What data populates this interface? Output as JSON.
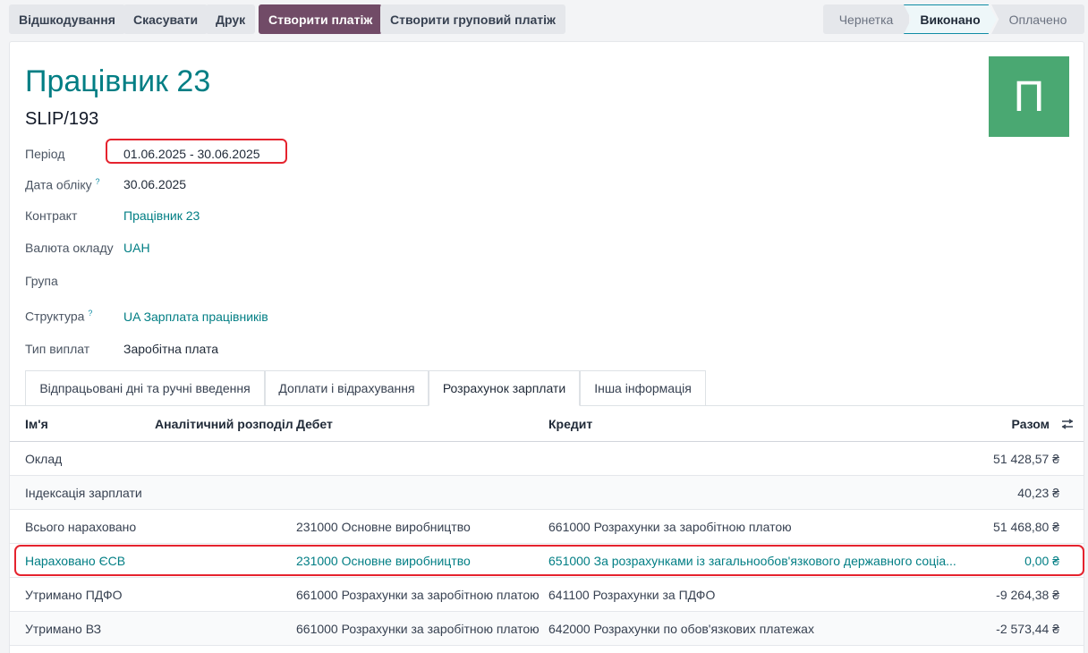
{
  "toolbar": {
    "refund": "Відшкодування",
    "cancel": "Скасувати",
    "print": "Друк",
    "create_payment": "Створити платіж",
    "create_group_payment": "Створити груповий платіж"
  },
  "status": {
    "draft": "Чернетка",
    "done": "Виконано",
    "paid": "Оплачено"
  },
  "employee": {
    "name": "Працівник 23",
    "slip": "SLIP/193",
    "avatar_letter": "П"
  },
  "fields": {
    "period_label": "Період",
    "period_value": "01.06.2025 - 30.06.2025",
    "accounting_date_label": "Дата обліку",
    "accounting_date_value": "30.06.2025",
    "contract_label": "Контракт",
    "contract_value": "Працівник 23",
    "currency_label": "Валюта окладу",
    "currency_value": "UAH",
    "group_label": "Група",
    "structure_label": "Структура",
    "structure_value": "UA Зарплата працівників",
    "payment_type_label": "Тип виплат",
    "payment_type_value": "Заробітна плата",
    "help_mark": "?"
  },
  "tabs": [
    "Відпрацьовані дні та ручні введення",
    "Доплати і відрахування",
    "Розрахунок зарплати",
    "Інша інформація"
  ],
  "table": {
    "headers": {
      "name": "Ім'я",
      "analytic": "Аналітичний розподіл",
      "debit": "Дебет",
      "credit": "Кредит",
      "total": "Разом"
    },
    "rows": [
      {
        "name": "Оклад",
        "debit": "",
        "credit": "",
        "total": "51 428,57 ₴"
      },
      {
        "name": "Індексація зарплати",
        "debit": "",
        "credit": "",
        "total": "40,23 ₴"
      },
      {
        "name": "Всього нараховано",
        "debit": "231000 Основне виробництво",
        "credit": "661000 Розрахунки за заробітною платою",
        "total": "51 468,80 ₴"
      },
      {
        "name": "Нараховано ЄСВ",
        "debit": "231000 Основне виробництво",
        "credit": "651000 За розрахунками із загальнообов'язкового державного соціа...",
        "total": "0,00 ₴"
      },
      {
        "name": "Утримано ПДФО",
        "debit": "661000 Розрахунки за заробітною платою",
        "credit": "641100 Розрахунки за ПДФО",
        "total": "-9 264,38 ₴"
      },
      {
        "name": "Утримано ВЗ",
        "debit": "661000 Розрахунки за заробітною платою",
        "credit": "642000 Розрахунки по обов'язкових платежах",
        "total": "-2 573,44 ₴"
      }
    ]
  },
  "colors": {
    "primary": "#714b67",
    "link": "#017e84",
    "avatar": "#4aa872",
    "highlight": "#e5232e"
  }
}
